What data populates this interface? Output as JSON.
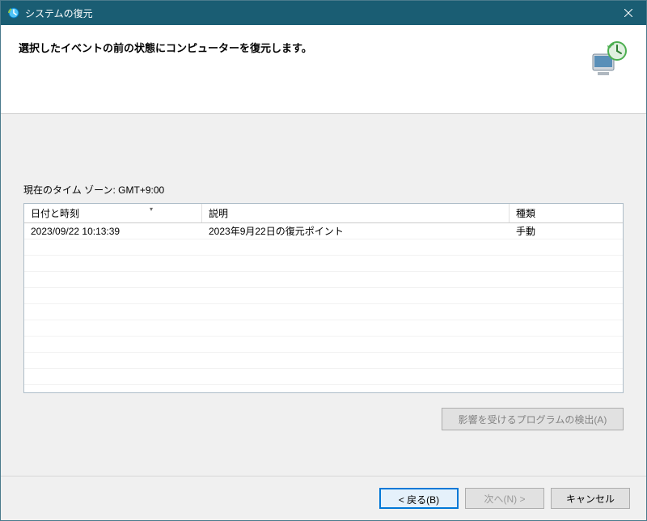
{
  "window": {
    "title": "システムの復元"
  },
  "header": {
    "heading": "選択したイベントの前の状態にコンピューターを復元します。"
  },
  "content": {
    "timezone_label": "現在のタイム ゾーン: GMT+9:00",
    "table": {
      "columns": {
        "datetime": "日付と時刻",
        "description": "説明",
        "type": "種類"
      },
      "rows": [
        {
          "datetime": "2023/09/22 10:13:39",
          "description": "2023年9月22日の復元ポイント",
          "type": "手動"
        }
      ]
    },
    "scan_button": "影響を受けるプログラムの検出(A)"
  },
  "footer": {
    "back": "< 戻る(B)",
    "next": "次へ(N) >",
    "cancel": "キャンセル"
  }
}
